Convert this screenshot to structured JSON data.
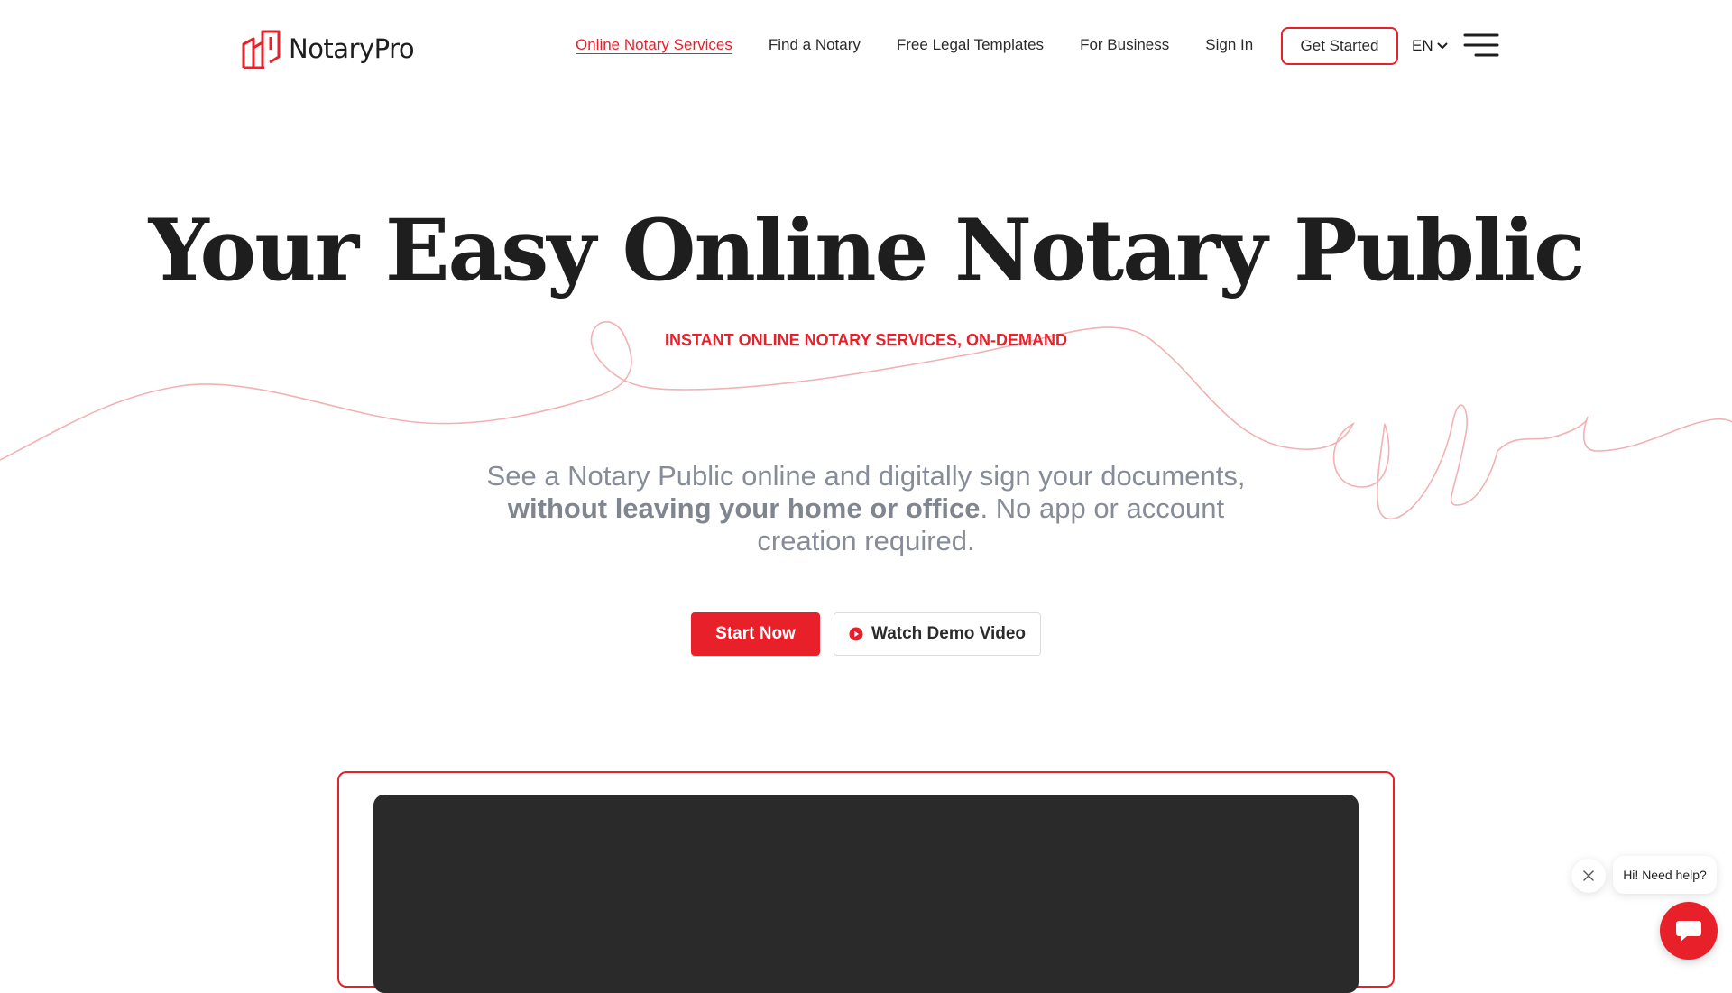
{
  "brand": {
    "name": "NotaryPro",
    "logo_icon": "notary-building-icon",
    "accent_color": "#e8202a"
  },
  "nav": {
    "items": [
      {
        "label": "Online Notary Services",
        "active": true
      },
      {
        "label": "Find a Notary",
        "active": false
      },
      {
        "label": "Free Legal Templates",
        "active": false
      },
      {
        "label": "For Business",
        "active": false
      },
      {
        "label": "Sign In",
        "active": false
      }
    ],
    "cta_label": "Get Started",
    "language": "EN",
    "menu_icon": "hamburger-icon"
  },
  "hero": {
    "title": "Your Easy Online Notary Public",
    "subtitle": "INSTANT ONLINE NOTARY SERVICES, ON-DEMAND",
    "description_start": "See a Notary Public online and digitally sign your documents, ",
    "description_bold": "without leaving your home or office",
    "description_end": ". No app or account creation required.",
    "primary_button": "Start Now",
    "secondary_button": "Watch Demo Video",
    "secondary_icon": "play-circle-icon"
  },
  "chat": {
    "greeting": "Hi! Need help?",
    "close_icon": "close-icon",
    "launcher_icon": "chat-icon"
  }
}
